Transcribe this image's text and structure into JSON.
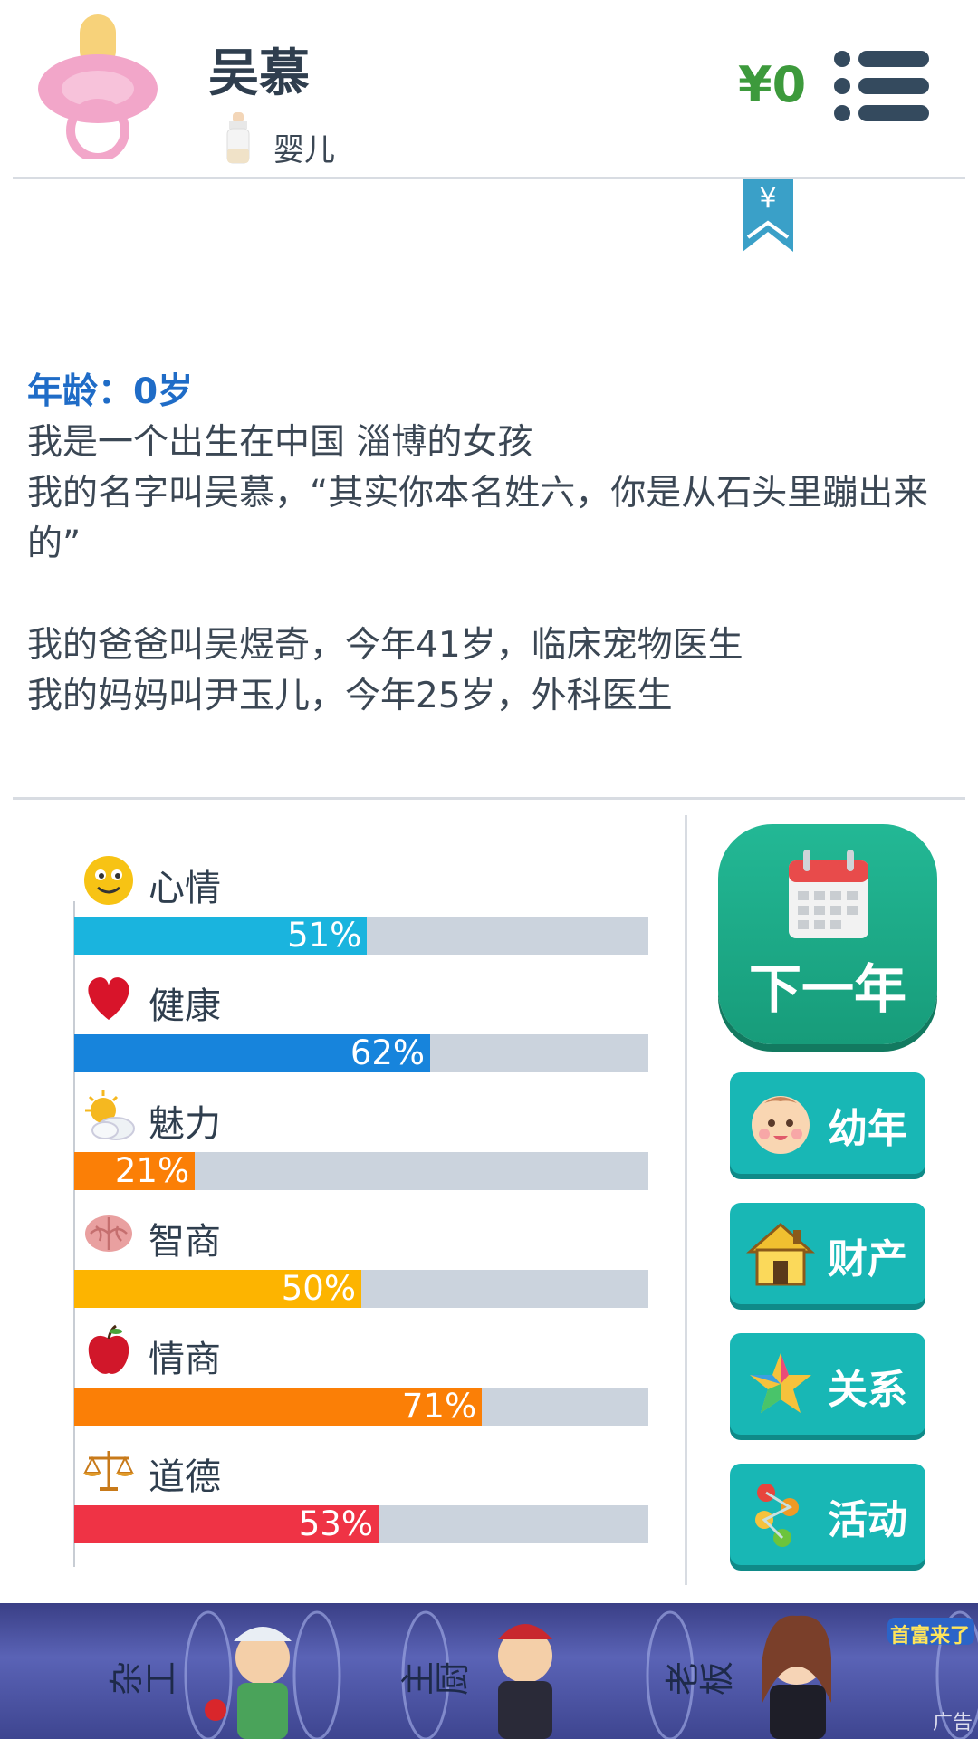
{
  "header": {
    "player_name": "吴慕",
    "stage": "婴儿",
    "money": "¥0",
    "menu_icon": "hamburger-menu-icon",
    "avatar_icon": "pacifier-icon",
    "stage_icon": "baby-bottle-icon"
  },
  "shop_ribbon": "¥",
  "story": {
    "age_line": "年龄：0岁",
    "lines": [
      "我是一个出生在中国 淄博的女孩",
      "我的名字叫吴慕，“其实你本名姓六，你是从石头里蹦出来的”",
      "",
      "我的爸爸叫吴煜奇，今年41岁，临床宠物医生",
      "我的妈妈叫尹玉儿，今年25岁，外科医生"
    ]
  },
  "stats": [
    {
      "label": "心情",
      "value": 51,
      "text": "51%",
      "color": "#1ab4de",
      "icon": "smiley-face-icon"
    },
    {
      "label": "健康",
      "value": 62,
      "text": "62%",
      "color": "#1784dc",
      "icon": "heart-icon"
    },
    {
      "label": "魅力",
      "value": 21,
      "text": "21%",
      "color": "#fb7f06",
      "icon": "sun-cloud-icon"
    },
    {
      "label": "智商",
      "value": 50,
      "text": "50%",
      "color": "#fdb400",
      "icon": "brain-icon"
    },
    {
      "label": "情商",
      "value": 71,
      "text": "71%",
      "color": "#fb7f06",
      "icon": "apple-icon"
    },
    {
      "label": "道德",
      "value": 53,
      "text": "53%",
      "color": "#ef3345",
      "icon": "scales-icon"
    }
  ],
  "actions": {
    "next_year": "下一年",
    "buttons": [
      {
        "label": "幼年",
        "icon": "baby-face-icon"
      },
      {
        "label": "财产",
        "icon": "house-icon"
      },
      {
        "label": "关系",
        "icon": "star-icon"
      },
      {
        "label": "活动",
        "icon": "dots-icon"
      }
    ]
  },
  "ad_banner": {
    "roles": [
      "杂工",
      "主厨",
      "老板"
    ],
    "badge": "首富来了",
    "tag": "广告"
  }
}
